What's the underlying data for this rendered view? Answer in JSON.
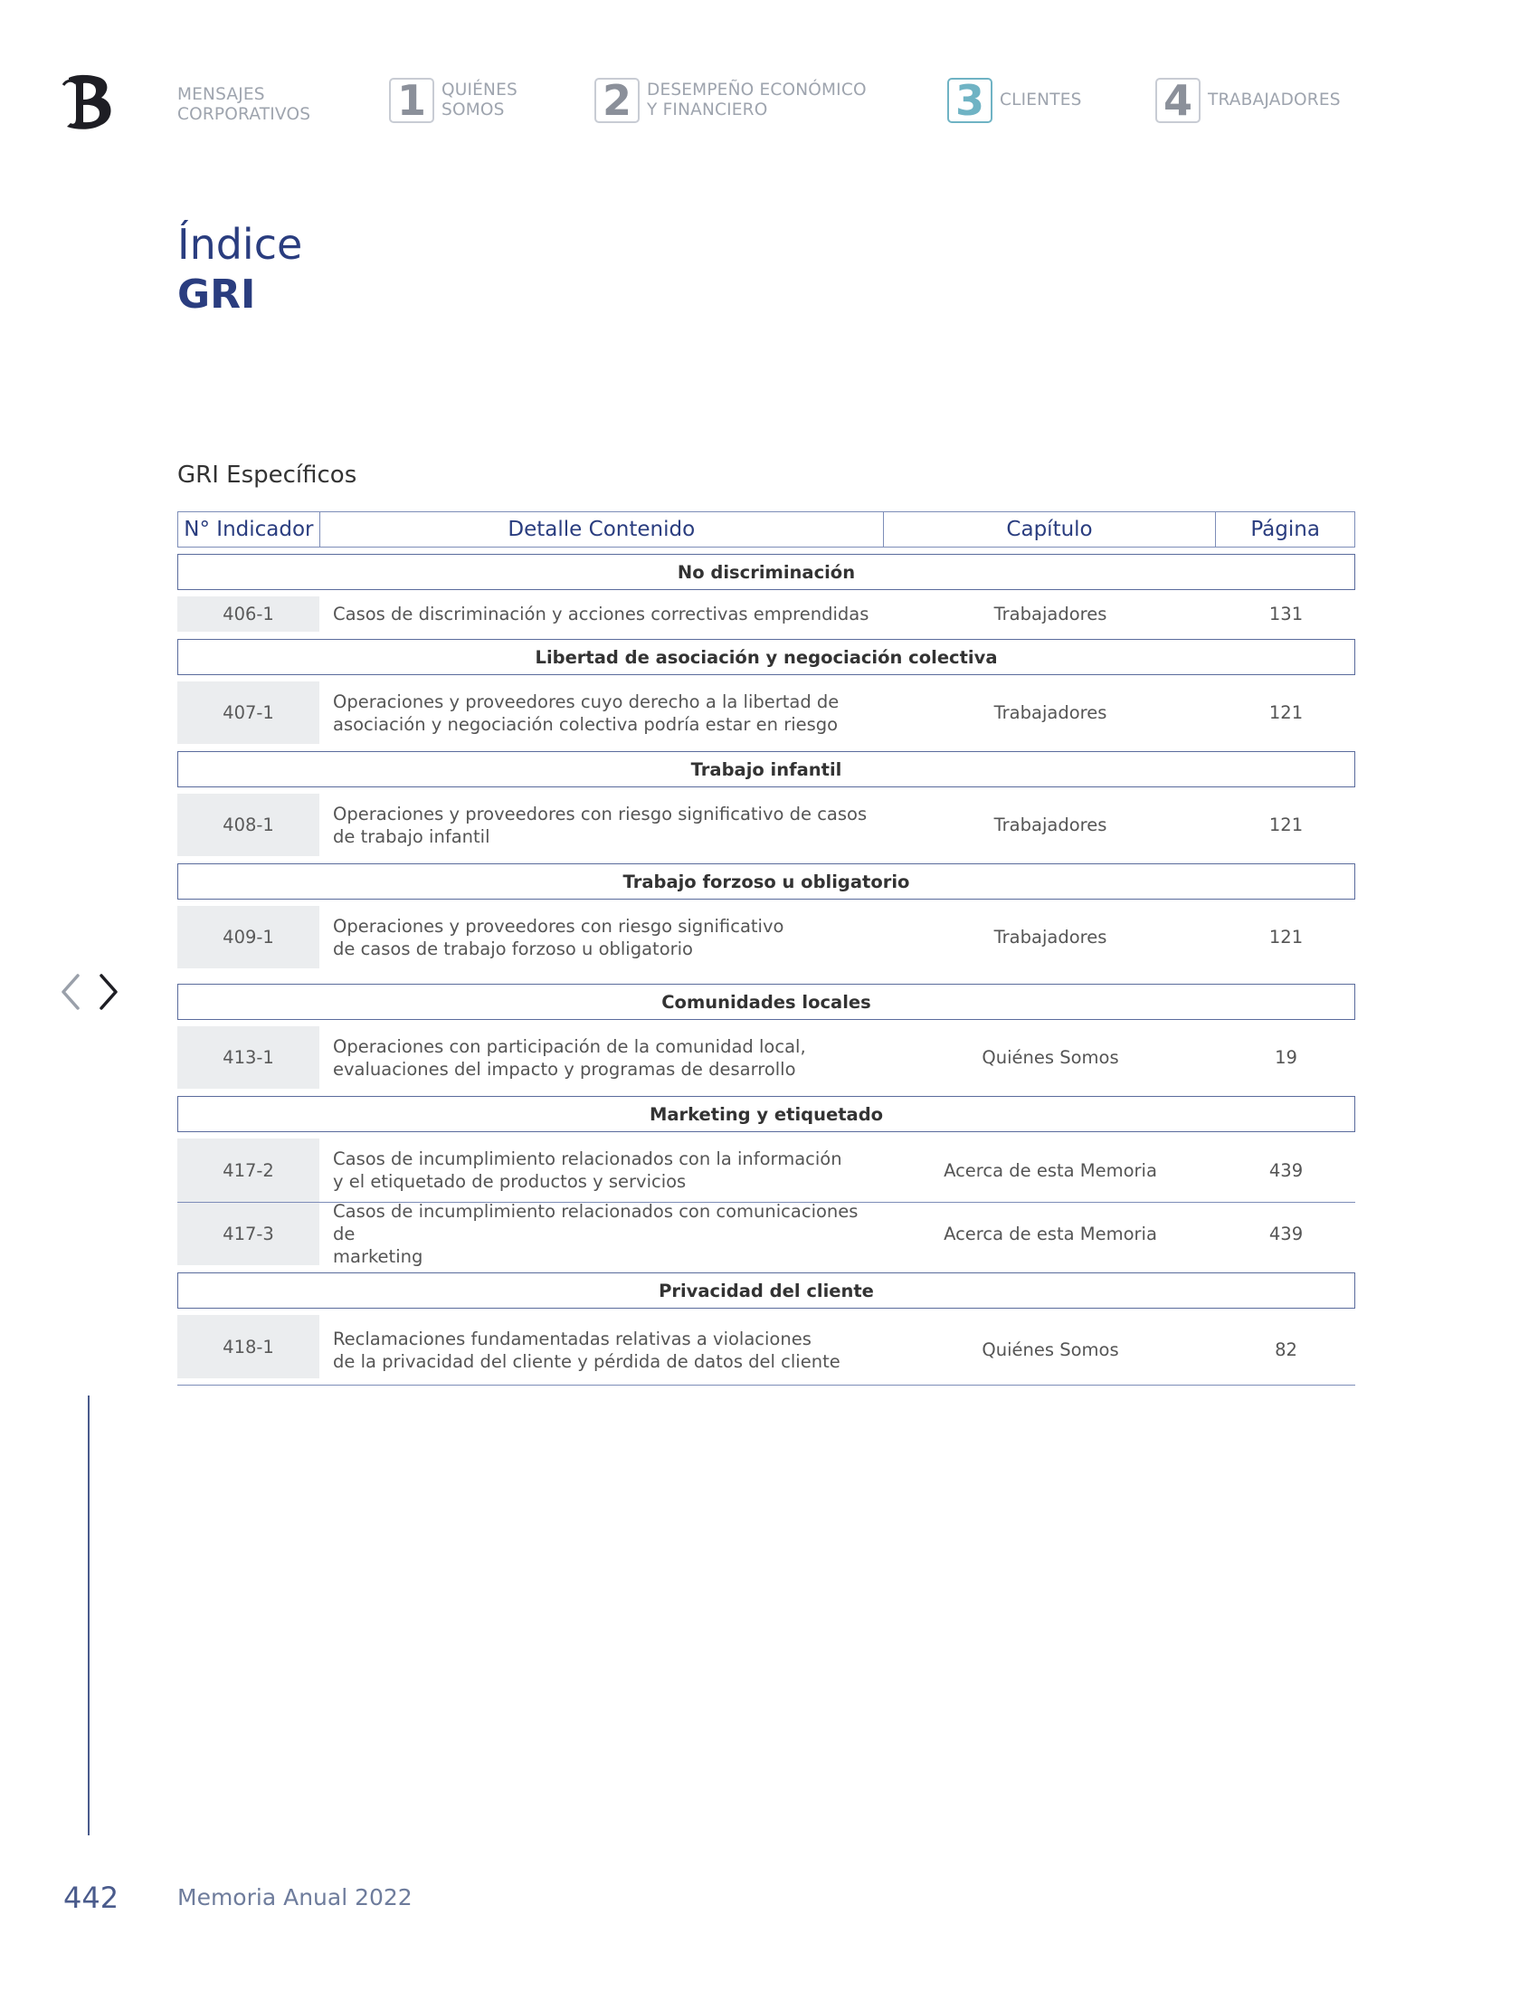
{
  "nav": {
    "mensajes": "MENSAJES\nCORPORATIVOS",
    "items": [
      {
        "num": "1",
        "label": "QUIÉNES\nSOMOS",
        "color": "#8b909a"
      },
      {
        "num": "2",
        "label": "DESEMPEÑO ECONÓMICO\nY FINANCIERO",
        "color": "#8b909a"
      },
      {
        "num": "3",
        "label": "CLIENTES",
        "color": "#6fb3c4"
      },
      {
        "num": "4",
        "label": "TRABAJADORES",
        "color": "#8b909a"
      }
    ]
  },
  "title": {
    "line1": "Índice",
    "line2": "GRI"
  },
  "section_title": "GRI Específicos",
  "table": {
    "headers": [
      "N° Indicador",
      "Detalle Contenido",
      "Capítulo",
      "Página"
    ],
    "groups": [
      {
        "category": "No discriminación",
        "rows": [
          {
            "code": "406-1",
            "detail": "Casos de discriminación y acciones correctivas emprendidas",
            "chapter": "Trabajadores",
            "page": "131"
          }
        ]
      },
      {
        "category": "Libertad de asociación y negociación colectiva",
        "rows": [
          {
            "code": "407-1",
            "detail": "Operaciones y proveedores cuyo derecho a la libertad de\nasociación y negociación colectiva podría estar en riesgo",
            "chapter": "Trabajadores",
            "page": "121"
          }
        ]
      },
      {
        "category": "Trabajo infantil",
        "rows": [
          {
            "code": "408-1",
            "detail": "Operaciones y proveedores con riesgo significativo de casos\nde trabajo infantil",
            "chapter": "Trabajadores",
            "page": "121"
          }
        ]
      },
      {
        "category": "Trabajo forzoso u obligatorio",
        "rows": [
          {
            "code": "409-1",
            "detail": "Operaciones y proveedores con riesgo significativo\nde casos de trabajo forzoso u obligatorio",
            "chapter": "Trabajadores",
            "page": "121"
          }
        ]
      },
      {
        "category": "Comunidades locales",
        "rows": [
          {
            "code": "413-1",
            "detail": "Operaciones con participación de la comunidad local,\nevaluaciones del impacto y programas de desarrollo",
            "chapter": "Quiénes Somos",
            "page": "19"
          }
        ]
      },
      {
        "category": "Marketing y etiquetado",
        "rows": [
          {
            "code": "417-2",
            "detail": "Casos de incumplimiento relacionados con la información\ny el etiquetado de productos y servicios",
            "chapter": "Acerca de esta Memoria",
            "page": "439"
          },
          {
            "code": "417-3",
            "detail": "Casos de incumplimiento relacionados con comunicaciones de\nmarketing",
            "chapter": "Acerca de esta Memoria",
            "page": "439"
          }
        ]
      },
      {
        "category": "Privacidad del cliente",
        "rows": [
          {
            "code": "418-1",
            "detail": "Reclamaciones fundamentadas relativas a violaciones\nde la privacidad del cliente y pérdida de datos del cliente",
            "chapter": "Quiénes Somos",
            "page": "82"
          }
        ]
      }
    ]
  },
  "footer": {
    "page_number": "442",
    "title": "Memoria Anual 2022"
  },
  "icons": {
    "logo": "bank-logo-icon",
    "prev": "chevron-left-icon",
    "next": "chevron-right-icon"
  },
  "colors": {
    "brand": "#2a3d7f",
    "accent": "#6fb3c4"
  }
}
